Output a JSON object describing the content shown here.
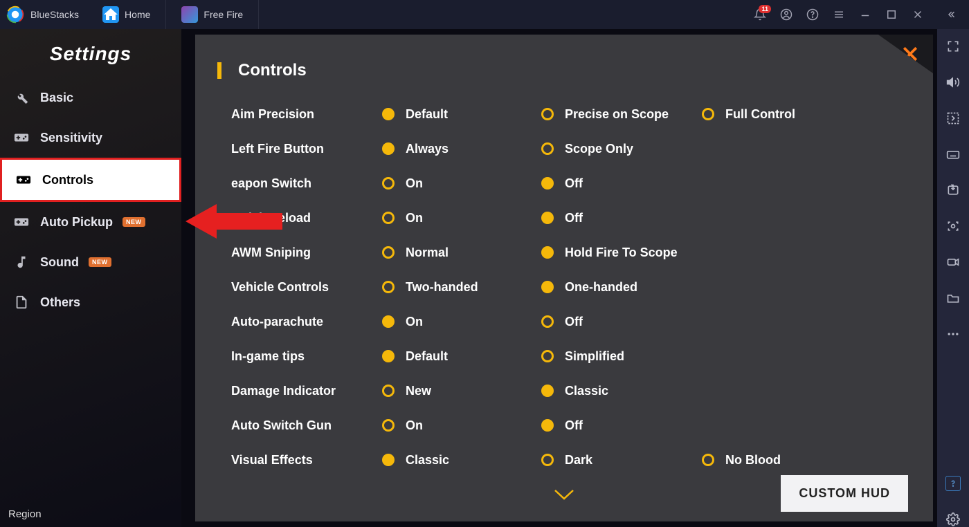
{
  "app": {
    "name": "BlueStacks"
  },
  "tabs": [
    {
      "label": "Home"
    },
    {
      "label": "Free Fire"
    }
  ],
  "notifications": {
    "count": "11"
  },
  "sidebar": {
    "title": "Settings",
    "items": [
      {
        "label": "Basic"
      },
      {
        "label": "Sensitivity"
      },
      {
        "label": "Controls"
      },
      {
        "label": "Auto Pickup",
        "new": "NEW"
      },
      {
        "label": "Sound",
        "new": "NEW"
      },
      {
        "label": "Others"
      }
    ],
    "region_label": "Region"
  },
  "panel": {
    "title": "Controls",
    "custom_hud": "CUSTOM HUD",
    "rows": [
      {
        "label": "Aim Precision",
        "opts": [
          "Default",
          "Precise on Scope",
          "Full Control"
        ],
        "sel": 0
      },
      {
        "label": "Left Fire Button",
        "opts": [
          "Always",
          "Scope Only"
        ],
        "sel": 0
      },
      {
        "label": "eapon Switch",
        "opts": [
          "On",
          "Off"
        ],
        "sel": 1
      },
      {
        "label": "Quick Reload",
        "opts": [
          "On",
          "Off"
        ],
        "sel": 1
      },
      {
        "label": "AWM Sniping",
        "opts": [
          "Normal",
          "Hold Fire To Scope"
        ],
        "sel": 1
      },
      {
        "label": "Vehicle Controls",
        "opts": [
          "Two-handed",
          "One-handed"
        ],
        "sel": 1
      },
      {
        "label": "Auto-parachute",
        "opts": [
          "On",
          "Off"
        ],
        "sel": 0
      },
      {
        "label": "In-game tips",
        "opts": [
          "Default",
          "Simplified"
        ],
        "sel": 0
      },
      {
        "label": "Damage Indicator",
        "opts": [
          "New",
          "Classic"
        ],
        "sel": 1
      },
      {
        "label": "Auto Switch Gun",
        "opts": [
          "On",
          "Off"
        ],
        "sel": 1
      },
      {
        "label": "Visual Effects",
        "opts": [
          "Classic",
          "Dark",
          "No Blood"
        ],
        "sel": 0
      }
    ]
  }
}
